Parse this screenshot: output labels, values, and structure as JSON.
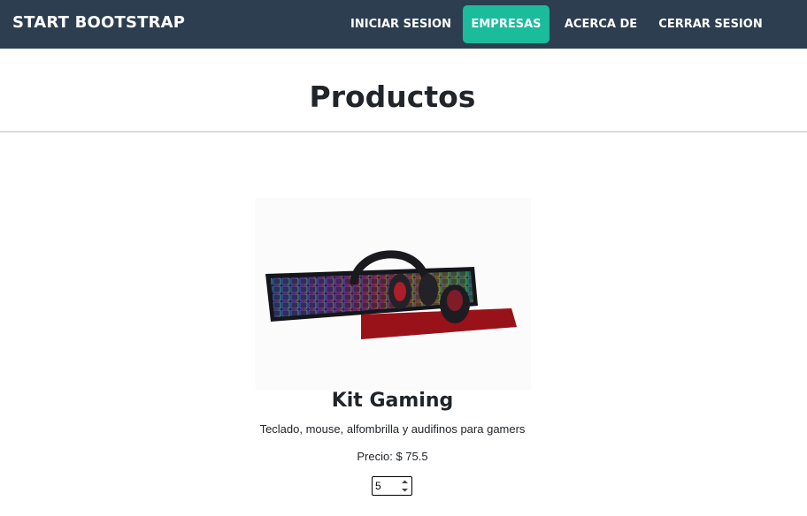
{
  "navbar": {
    "brand": "START BOOTSTRAP",
    "items": [
      {
        "label": "INICIAR SESION",
        "active": false
      },
      {
        "label": "EMPRESAS",
        "active": true
      },
      {
        "label": "ACERCA DE",
        "active": false
      },
      {
        "label": "CERRAR SESION",
        "active": false
      }
    ]
  },
  "main": {
    "title": "Productos",
    "product": {
      "image_icon": "gaming-kit-image",
      "name": "Kit Gaming",
      "description": "Teclado, mouse, alfombrilla y audifinos para gamers",
      "price_label": "Precio: $ 75.5",
      "quantity": "5"
    }
  },
  "colors": {
    "navbar_bg": "#2c3e50",
    "accent": "#1abc9c",
    "text": "#212529"
  }
}
